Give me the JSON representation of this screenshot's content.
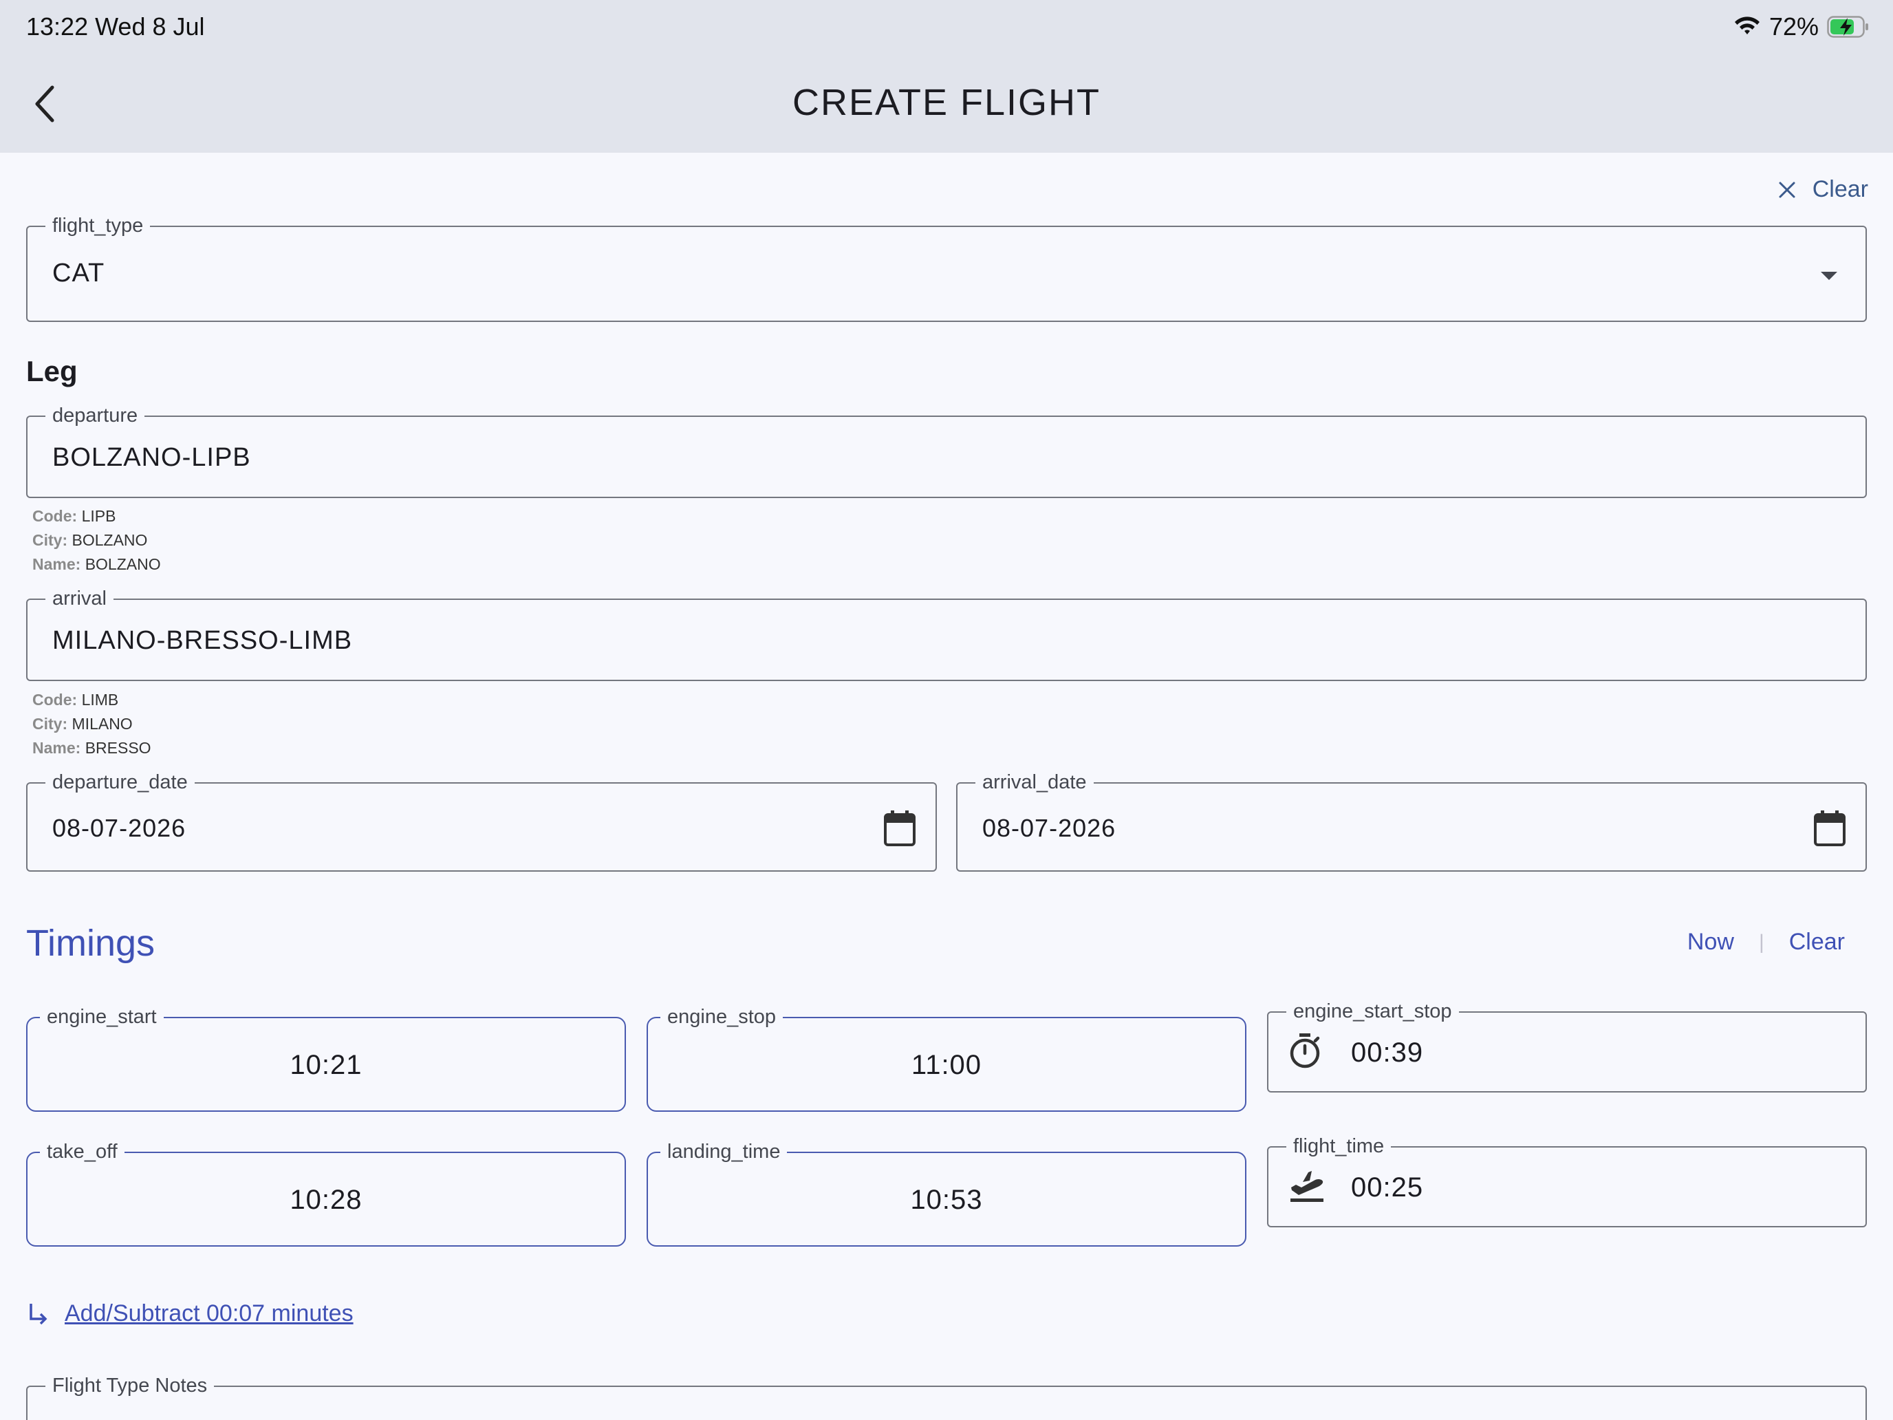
{
  "status_bar": {
    "time_date": "13:22   Wed 8 Jul",
    "battery_percent": "72%",
    "battery_level": 0.72
  },
  "header": {
    "title": "CREATE FLIGHT"
  },
  "form": {
    "clear_label": "Clear",
    "flight_type": {
      "label": "flight_type",
      "value": "CAT"
    },
    "leg_title": "Leg",
    "departure": {
      "label": "departure",
      "value": "BOLZANO-LIPB",
      "info": {
        "code_key": "Code:",
        "code": "LIPB",
        "city_key": "City:",
        "city": "BOLZANO",
        "name_key": "Name:",
        "name": "BOLZANO"
      }
    },
    "arrival": {
      "label": "arrival",
      "value": "MILANO-BRESSO-LIMB",
      "info": {
        "code_key": "Code:",
        "code": "LIMB",
        "city_key": "City:",
        "city": "MILANO",
        "name_key": "Name:",
        "name": "BRESSO"
      }
    },
    "departure_date": {
      "label": "departure_date",
      "value": "08-07-2026"
    },
    "arrival_date": {
      "label": "arrival_date",
      "value": "08-07-2026"
    }
  },
  "timings": {
    "title": "Timings",
    "now_label": "Now",
    "separator": "|",
    "clear_label": "Clear",
    "engine_start": {
      "label": "engine_start",
      "value": "10:21"
    },
    "engine_stop": {
      "label": "engine_stop",
      "value": "11:00"
    },
    "engine_start_stop": {
      "label": "engine_start_stop",
      "value": "00:39",
      "icon": "timer-icon"
    },
    "take_off": {
      "label": "take_off",
      "value": "10:28"
    },
    "landing_time": {
      "label": "landing_time",
      "value": "10:53"
    },
    "flight_time": {
      "label": "flight_time",
      "value": "00:25",
      "icon": "flight-takeoff-icon"
    },
    "adjust_link": "Add/Subtract 00:07 minutes"
  },
  "notes": {
    "label": "Flight Type Notes"
  },
  "colors": {
    "accent": "#3f51b5",
    "header_bg": "#e1e4ec",
    "page_bg": "#f7f8fd",
    "field_border": "#74777f"
  }
}
